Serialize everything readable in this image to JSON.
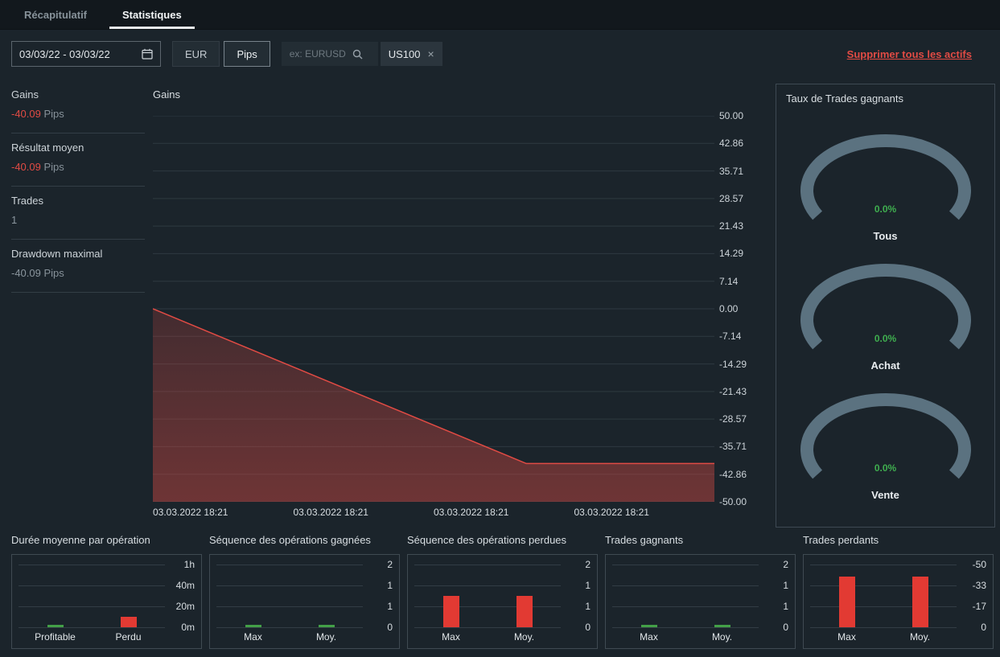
{
  "tabs": {
    "recap": "Récapitulatif",
    "stats": "Statistiques"
  },
  "toolbar": {
    "date_range": "03/03/22 - 03/03/22",
    "currency": "EUR",
    "unit": "Pips",
    "search_placeholder": "ex: EURUSD",
    "asset_chip": "US100",
    "chip_close": "×",
    "remove_all": "Supprimer tous les actifs"
  },
  "summary": {
    "items": [
      {
        "label": "Gains",
        "value": "-40.09",
        "unit": "Pips"
      },
      {
        "label": "Résultat moyen",
        "value": "-40.09",
        "unit": "Pips"
      },
      {
        "label": "Trades",
        "value": "1",
        "unit": ""
      },
      {
        "label": "Drawdown maximal",
        "value": "-40.09",
        "unit": "Pips"
      }
    ]
  },
  "colors": {
    "negative": "#e14b44",
    "positive": "#3fae4f",
    "gauge_arc": "#5b7280",
    "bar_red": "#e23a33",
    "bar_green": "#43a047"
  },
  "chart_data": [
    {
      "type": "area",
      "title": "Gains",
      "ylim": [
        -50,
        50
      ],
      "y_ticks": [
        "50.00",
        "42.86",
        "35.71",
        "28.57",
        "21.43",
        "14.29",
        "7.14",
        "0.00",
        "-7.14",
        "-14.29",
        "-21.43",
        "-28.57",
        "-35.71",
        "-42.86",
        "-50.00"
      ],
      "x_labels": [
        "03.03.2022 18:21",
        "03.03.2022 18:21",
        "03.03.2022 18:21",
        "03.03.2022 18:21"
      ],
      "points": [
        {
          "x": 0,
          "y": 0
        },
        {
          "x": 0.665,
          "y": -40.09
        },
        {
          "x": 1,
          "y": -40.09
        }
      ],
      "line_color": "#e14b44",
      "grid": "horizontal",
      "ylabel_side": "right"
    },
    {
      "type": "gauge",
      "title": "Taux de Trades gagnants",
      "items": [
        {
          "label": "Tous",
          "value": "0.0%"
        },
        {
          "label": "Achat",
          "value": "0.0%"
        },
        {
          "label": "Vente",
          "value": "0.0%"
        }
      ]
    },
    {
      "type": "bar",
      "title": "Durée moyenne par opération",
      "categories": [
        "Profitable",
        "Perdu"
      ],
      "values": [
        0,
        10
      ],
      "ylim": [
        0,
        60
      ],
      "y_tick_labels": [
        "1h",
        "40m",
        "20m",
        "0m"
      ],
      "bar_colors": [
        "#43a047",
        "#e23a33"
      ]
    },
    {
      "type": "bar",
      "title": "Séquence des opérations gagnées",
      "categories": [
        "Max",
        "Moy."
      ],
      "values": [
        0,
        0
      ],
      "ylim": [
        0,
        2
      ],
      "y_tick_labels": [
        "2",
        "1",
        "1",
        "0"
      ],
      "bar_colors": [
        "#43a047",
        "#43a047"
      ]
    },
    {
      "type": "bar",
      "title": "Séquence des opérations perdues",
      "categories": [
        "Max",
        "Moy."
      ],
      "values": [
        1,
        1
      ],
      "ylim": [
        0,
        2
      ],
      "y_tick_labels": [
        "2",
        "1",
        "1",
        "0"
      ],
      "bar_colors": [
        "#e23a33",
        "#e23a33"
      ]
    },
    {
      "type": "bar",
      "title": "Trades gagnants",
      "categories": [
        "Max",
        "Moy."
      ],
      "values": [
        0,
        0
      ],
      "ylim": [
        0,
        2
      ],
      "y_tick_labels": [
        "2",
        "1",
        "1",
        "0"
      ],
      "bar_colors": [
        "#43a047",
        "#43a047"
      ]
    },
    {
      "type": "bar",
      "title": "Trades perdants",
      "categories": [
        "Max",
        "Moy."
      ],
      "values": [
        -40.09,
        -40.09
      ],
      "ylim": [
        0,
        -50
      ],
      "y_tick_labels": [
        "-50",
        "-33",
        "-17",
        "0"
      ],
      "bar_colors": [
        "#e23a33",
        "#e23a33"
      ]
    }
  ]
}
